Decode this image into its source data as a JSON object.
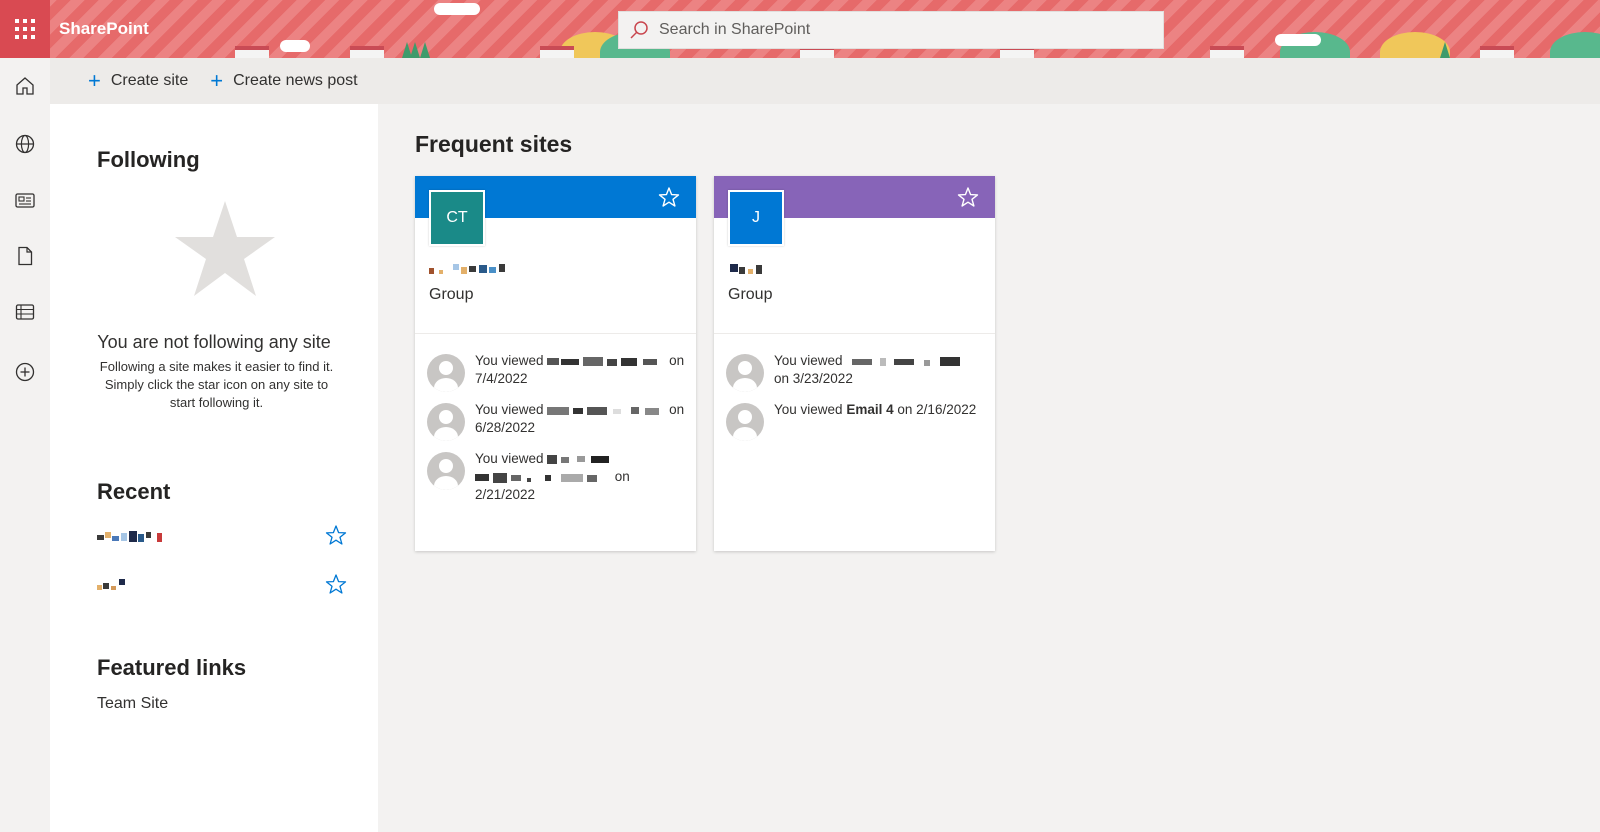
{
  "suitebar": {
    "brand": "SharePoint",
    "search_placeholder": "Search in SharePoint"
  },
  "commands": {
    "create_site": "Create site",
    "create_news_post": "Create news post"
  },
  "following": {
    "title": "Following",
    "empty_title": "You are not following any site",
    "empty_desc": "Following a site makes it easier to find it. Simply click the star icon on any site to start following it."
  },
  "recent": {
    "title": "Recent"
  },
  "featured": {
    "title": "Featured links",
    "links": [
      "Team Site"
    ]
  },
  "frequent": {
    "title": "Frequent sites",
    "cards": [
      {
        "initials": "CT",
        "type": "Group",
        "header_color": "#0078d4",
        "logo_color": "#1a8a88",
        "activities": [
          {
            "prefix": "You viewed",
            "suffix": "on 7/4/2022"
          },
          {
            "prefix": "You viewed",
            "suffix": "on 6/28/2022"
          },
          {
            "prefix": "You viewed",
            "suffix": "on",
            "date": "2/21/2022"
          }
        ]
      },
      {
        "initials": "J",
        "type": "Group",
        "header_color": "#8764b8",
        "logo_color": "#0078d4",
        "activities": [
          {
            "prefix": "You viewed",
            "suffix": "on 3/23/2022"
          },
          {
            "prefix": "You viewed",
            "item": "Email 4",
            "suffix": "on",
            "date": "2/16/2022"
          }
        ]
      }
    ]
  },
  "colors": {
    "accent": "#0078d4",
    "suitebar": "#e66a6a"
  }
}
